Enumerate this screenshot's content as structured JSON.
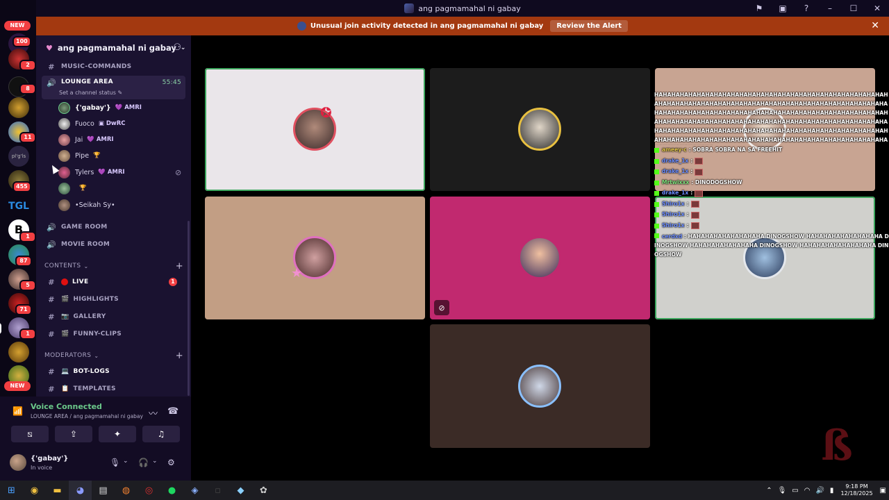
{
  "titlebar": {
    "title": "ang pagmamahal ni gabay"
  },
  "alert": {
    "text": "Unusual join activity detected in ang pagmamahal ni gabay",
    "button": "Review the Alert"
  },
  "rail": {
    "new_top": "NEW",
    "new_bottom": "NEW",
    "badges": [
      "100",
      "2",
      "8",
      "11",
      "455",
      "1",
      "87",
      "5",
      "71",
      "1"
    ],
    "text_server": "pl'g'ls"
  },
  "server": {
    "name": "ang pagmamahal ni gabay"
  },
  "channels": {
    "music": "MUSIC-COMMANDS",
    "lounge": "LOUNGE AREA",
    "lounge_time": "55:45",
    "lounge_status": "Set a channel status",
    "game": "GAME ROOM",
    "movie": "MOVIE ROOM"
  },
  "voice_users": [
    {
      "name": "{'gabay'}",
      "tag": "AMRI"
    },
    {
      "name": "Fuoco",
      "tag": "DwRC"
    },
    {
      "name": "Jai",
      "tag": "AMRI"
    },
    {
      "name": "Pipe",
      "tag": ""
    },
    {
      "name": "Tylers",
      "tag": "AMRI"
    },
    {
      "name": "",
      "tag": ""
    },
    {
      "name": "•Seikah Sy•",
      "tag": ""
    }
  ],
  "categories": {
    "contents": "CONTENTS",
    "moderators": "MODERATORS"
  },
  "content_channels": [
    "LIVE",
    "HIGHLIGHTS",
    "GALLERY",
    "FUNNY-CLIPS"
  ],
  "live_mentions": "1",
  "mod_channels": [
    "BOT-LOGS",
    "TEMPLATES"
  ],
  "voice_panel": {
    "title": "Voice Connected",
    "subtitle": "LOUNGE AREA / ang pagmamahal ni gabay"
  },
  "user": {
    "name": "{'gabay'}",
    "status": "In voice"
  },
  "overlay": {
    "spam": "HAHAHAHAHAHAHAHAHAHAHAHAHAHAHAHAHAHAHAHAHAHAHAHAHAHAHAHAHAHAHAHAHAHAHAHAHAHAHAHAHAHAHAHAHAHAHAHAHAHAHAHAHAHAHAHAHAHAHAHAHAHAHAHAHAHAHAHAHAHAHAHAHAHAHAHAHAHAHAHAHAHAHAHAHAHAHAHAHAHAHAHAHAHAHAHAHAHAHAHAHAHAHAHAHAHAHAHAHAHAHAHAHAHAHAHAHAHAHAHAHAHAHAHAHAHAHAHAHAHAHAHAHAHAHAHAHAHAHAHAHAHAHAHAHAHAHAHAHAHAHAHAHAHAHAHAHAHAHAHAHAHAHAHAHAHAHAHAHAHAHAHA",
    "lines": [
      {
        "name": "ameey·c",
        "msg": ": SOBRA SOBRA NA SA FREEHIT",
        "emote": false,
        "color": "y"
      },
      {
        "name": "drake_1x",
        "msg": ":",
        "emote": true,
        "color": "b"
      },
      {
        "name": "drake_1x",
        "msg": ":",
        "emote": true,
        "color": "b"
      },
      {
        "name": "Mrtwixxx",
        "msg": ": DINODOGSHOW",
        "emote": false,
        "color": "g"
      },
      {
        "name": "drake_1x",
        "msg": ":",
        "emote": true,
        "color": "b"
      },
      {
        "name": "Shiro1x",
        "msg": ":",
        "emote": true,
        "color": "b"
      },
      {
        "name": "Shiro1x",
        "msg": ":",
        "emote": true,
        "color": "b"
      },
      {
        "name": "Shiro1x",
        "msg": ":",
        "emote": true,
        "color": "b"
      }
    ],
    "last_name": "cerdxd",
    "last_msg": ": HAHAHAHAHAHAHAHAHA DINOGSHOW HAHAHAHAHAHAHAHAHA DINOGSHOW HAHAHAHAHAHAHAHA DINOGSHOW HAHAHAHAHAHAHAHAHA DINOGSHOW"
  },
  "taskbar": {
    "time": "9:18 PM",
    "date": "12/18/2025"
  }
}
